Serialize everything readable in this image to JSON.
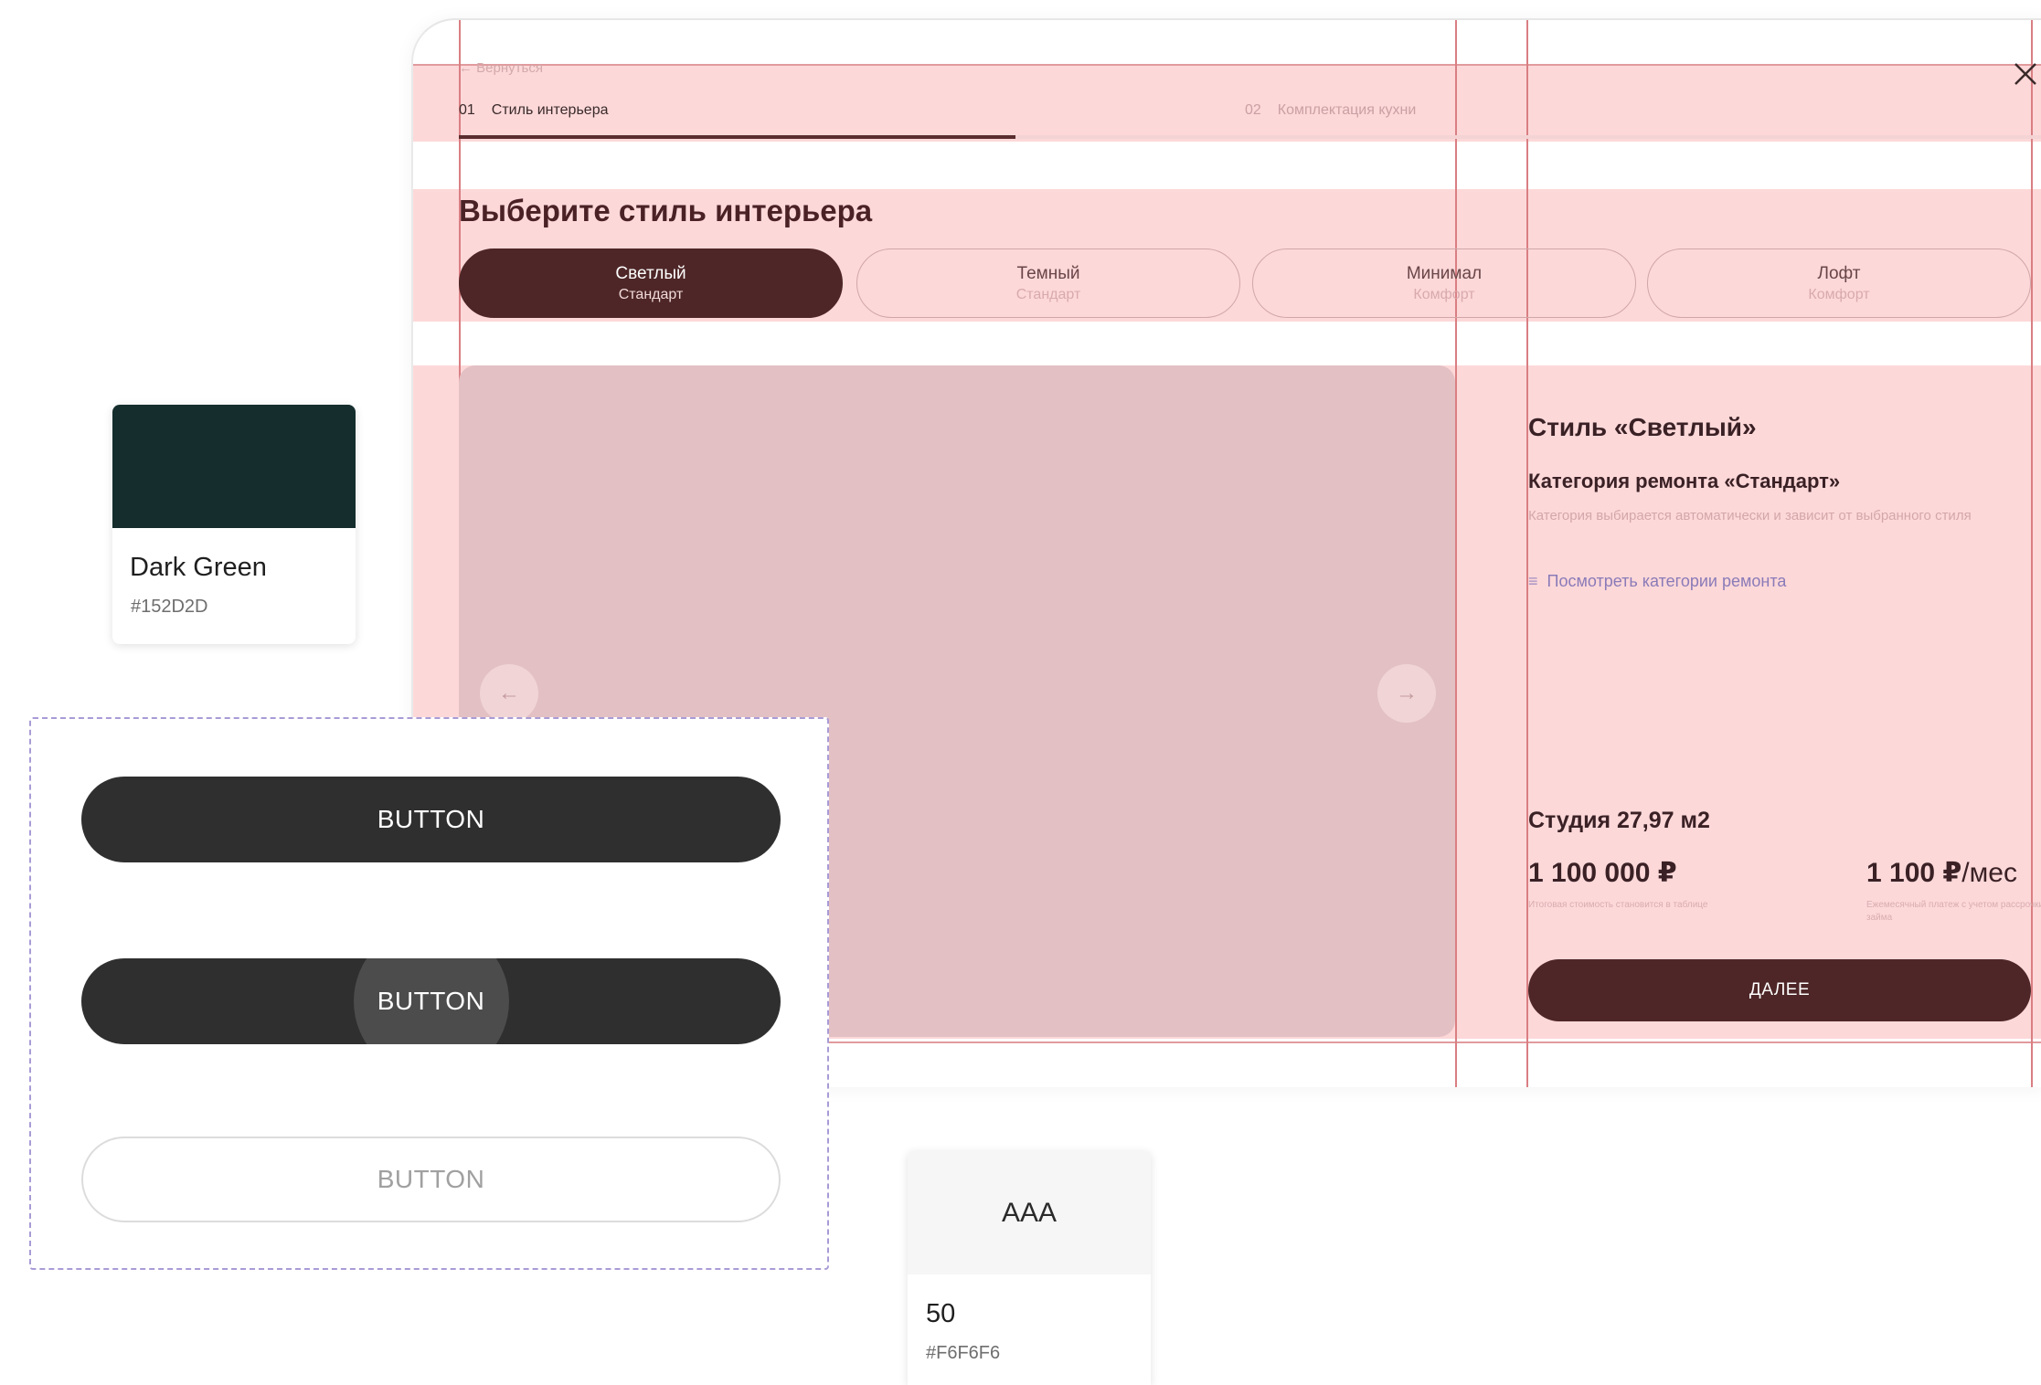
{
  "window": {
    "back_link": "← Вернуться",
    "steps": [
      {
        "num": "01",
        "label": "Стиль интерьера"
      },
      {
        "num": "02",
        "label": "Комплектация кухни"
      }
    ],
    "progress": 0.35,
    "title": "Выберите стиль интерьера",
    "style_tabs": [
      {
        "name": "Светлый",
        "category": "Стандарт",
        "active": true
      },
      {
        "name": "Темный",
        "category": "Стандарт",
        "active": false
      },
      {
        "name": "Минимал",
        "category": "Комфорт",
        "active": false
      },
      {
        "name": "Лофт",
        "category": "Комфорт",
        "active": false
      }
    ],
    "carousel": {
      "prev_icon": "arrow-left-icon",
      "next_icon": "arrow-right-icon"
    },
    "info": {
      "style_title": "Стиль «Светлый»",
      "category_title": "Категория ремонта «Стандарт»",
      "category_desc": "Категория выбирается автоматически и зависит от выбранного стиля",
      "link_label": "Посмотреть категории ремонта",
      "apartment": "Студия 27,97 м2",
      "price_total": "1 100 000 ₽",
      "price_total_note": "Итоговая стоимость становится в таблице",
      "price_monthly": "1 100 ₽",
      "price_monthly_unit": "/мес",
      "price_monthly_note": "Ежемесячный платеж с учетом рассрочки займа"
    },
    "next_label": "ДАЛЕЕ"
  },
  "swatch": {
    "name": "Dark Green",
    "hex": "#152D2D",
    "color": "#152D2D"
  },
  "buttons": [
    {
      "label": "BUTTON",
      "variant": "filled"
    },
    {
      "label": "BUTTON",
      "variant": "filled-pressed"
    },
    {
      "label": "BUTTON",
      "variant": "outline"
    }
  ],
  "tone": {
    "sample": "AAA",
    "level": "50",
    "hex": "#F6F6F6",
    "color": "#F6F6F6"
  },
  "colors": {
    "grid_overlay": "#fdd8d9",
    "primary_brown": "#4e2627",
    "link_purple": "#8a7bb8",
    "button_dark": "#2f2f2f"
  }
}
